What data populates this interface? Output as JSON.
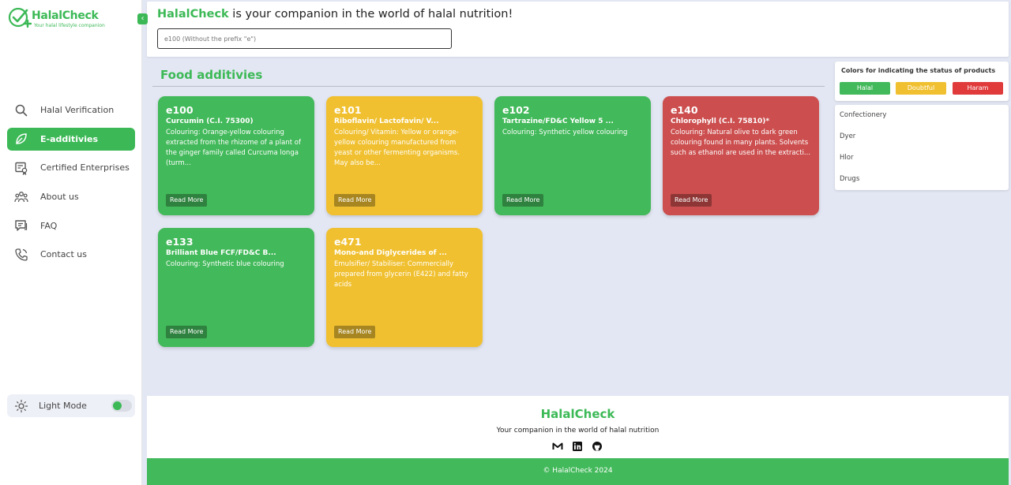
{
  "brand": {
    "name": "HalalCheck",
    "tagline": "Your halal lifestyle companion"
  },
  "nav": {
    "items": [
      {
        "label": "Halal Verification",
        "icon": "search-icon",
        "active": false
      },
      {
        "label": "E-additivies",
        "icon": "leaf-icon",
        "active": true
      },
      {
        "label": "Certified Enterprises",
        "icon": "certificate-icon",
        "active": false
      },
      {
        "label": "About us",
        "icon": "users-icon",
        "active": false
      },
      {
        "label": "FAQ",
        "icon": "message-icon",
        "active": false
      },
      {
        "label": "Contact us",
        "icon": "phone-icon",
        "active": false
      }
    ],
    "mode_label": "Light Mode"
  },
  "header": {
    "brand": "HalalCheck",
    "title_rest": " is your companion in the world of halal nutrition!",
    "search_placeholder": "e100 (Without the prefix \"e\")"
  },
  "section": {
    "title": "Food additivies"
  },
  "cards": [
    {
      "code": "e100",
      "name": "Curcumin (C.I. 75300)",
      "desc": "Colouring: Orange-yellow colouring extracted from the rhizome of a plant of the ginger family called Curcuma longa (turm...",
      "status": "halal",
      "more": "Read More"
    },
    {
      "code": "e101",
      "name": "Riboflavin/ Lactofavin/ V...",
      "desc": "Colouring/ Vitamin: Yellow or orange-yellow colouring manufactured from yeast or other fermenting organisms. May also be...",
      "status": "doubtful",
      "more": "Read More"
    },
    {
      "code": "e102",
      "name": "Tartrazine/FD&C Yellow 5 ...",
      "desc": "Colouring: Synthetic yellow colouring",
      "status": "halal",
      "more": "Read More"
    },
    {
      "code": "e140",
      "name": "Chlorophyll (C.I. 75810)*",
      "desc": "Colouring: Natural olive to dark green colouring found in many plants. Solvents such as ethanol are used in the extracti...",
      "status": "haram",
      "more": "Read More"
    },
    {
      "code": "e133",
      "name": "Brilliant Blue FCF/FD&C B...",
      "desc": "Colouring: Synthetic blue colouring",
      "status": "halal",
      "more": "Read More"
    },
    {
      "code": "e471",
      "name": "Mono-and Diglycerides of ...",
      "desc": "Emulsifier/ Stabiliser: Commercially prepared from glycerin (E422) and fatty acids",
      "status": "doubtful",
      "more": "Read More"
    }
  ],
  "legend": {
    "title": "Colors for indicating the status of products",
    "halal": "Halal",
    "doubtful": "Doubtful",
    "haram": "Haram",
    "colors": {
      "halal": "#42b95a",
      "doubtful": "#f0c030",
      "haram": "#e03a3a"
    }
  },
  "categories": [
    "Confectionery",
    "Dyer",
    "Hlor",
    "Drugs"
  ],
  "footer": {
    "brand": "HalalCheck",
    "tagline": "Your companion in the world of halal nutrition",
    "socials": [
      "gmail-icon",
      "linkedin-icon",
      "github-icon"
    ],
    "copyright": "© HalalCheck 2024"
  }
}
